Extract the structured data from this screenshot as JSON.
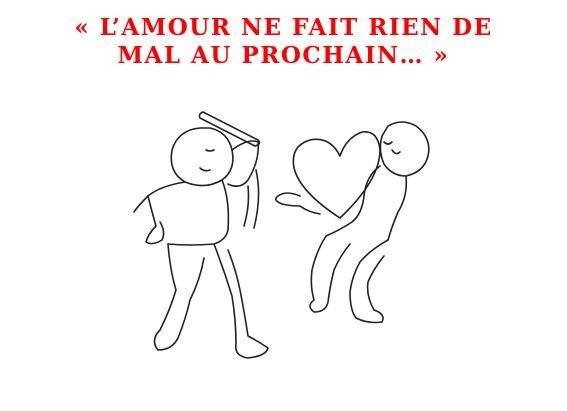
{
  "caption": {
    "line1": "« L’amour ne fait rien de",
    "line2": "mal au prochain… »"
  },
  "colors": {
    "title": "#ff0000",
    "background": "#ffffff",
    "lineart": "#222222"
  }
}
